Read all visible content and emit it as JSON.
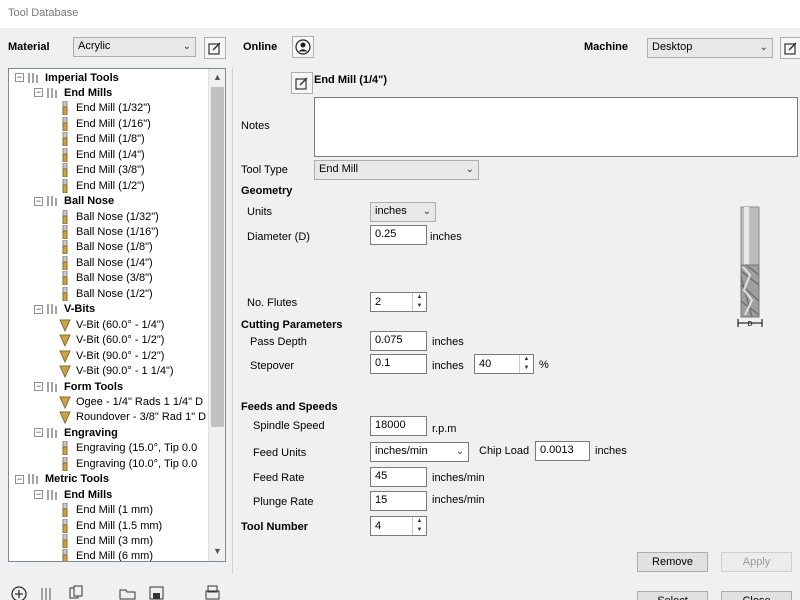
{
  "window": {
    "title": "Tool Database"
  },
  "top": {
    "material_label": "Material",
    "material_value": "Acrylic",
    "online_label": "Online",
    "machine_label": "Machine",
    "machine_value": "Desktop"
  },
  "tree": {
    "items": [
      {
        "label": "Imperial Tools",
        "level": 0,
        "kind": "group"
      },
      {
        "label": "End Mills",
        "level": 1,
        "kind": "group"
      },
      {
        "label": "End Mill (1/32\")",
        "level": 2,
        "kind": "endmill"
      },
      {
        "label": "End Mill (1/16\")",
        "level": 2,
        "kind": "endmill"
      },
      {
        "label": "End Mill (1/8\")",
        "level": 2,
        "kind": "endmill"
      },
      {
        "label": "End Mill (1/4\")",
        "level": 2,
        "kind": "endmill"
      },
      {
        "label": "End Mill (3/8\")",
        "level": 2,
        "kind": "endmill"
      },
      {
        "label": "End Mill (1/2\")",
        "level": 2,
        "kind": "endmill"
      },
      {
        "label": "Ball Nose",
        "level": 1,
        "kind": "group"
      },
      {
        "label": "Ball Nose (1/32\")",
        "level": 2,
        "kind": "endmill"
      },
      {
        "label": "Ball Nose (1/16\")",
        "level": 2,
        "kind": "endmill"
      },
      {
        "label": "Ball Nose (1/8\")",
        "level": 2,
        "kind": "endmill"
      },
      {
        "label": "Ball Nose (1/4\")",
        "level": 2,
        "kind": "endmill"
      },
      {
        "label": "Ball Nose (3/8\")",
        "level": 2,
        "kind": "endmill"
      },
      {
        "label": "Ball Nose (1/2\")",
        "level": 2,
        "kind": "endmill"
      },
      {
        "label": "V-Bits",
        "level": 1,
        "kind": "group"
      },
      {
        "label": "V-Bit (60.0° - 1/4\")",
        "level": 2,
        "kind": "vbit"
      },
      {
        "label": "V-Bit (60.0° - 1/2\")",
        "level": 2,
        "kind": "vbit"
      },
      {
        "label": "V-Bit (90.0° - 1/2\")",
        "level": 2,
        "kind": "vbit"
      },
      {
        "label": "V-Bit (90.0° - 1 1/4\")",
        "level": 2,
        "kind": "vbit"
      },
      {
        "label": "Form Tools",
        "level": 1,
        "kind": "group"
      },
      {
        "label": "Ogee - 1/4\" Rads 1 1/4\" D",
        "level": 2,
        "kind": "vbit"
      },
      {
        "label": "Roundover - 3/8\" Rad 1\" D",
        "level": 2,
        "kind": "vbit"
      },
      {
        "label": "Engraving",
        "level": 1,
        "kind": "group"
      },
      {
        "label": "Engraving (15.0°, Tip 0.0",
        "level": 2,
        "kind": "endmill"
      },
      {
        "label": "Engraving (10.0°, Tip 0.0",
        "level": 2,
        "kind": "endmill"
      },
      {
        "label": "Metric Tools",
        "level": 0,
        "kind": "group"
      },
      {
        "label": "End Mills",
        "level": 1,
        "kind": "group"
      },
      {
        "label": "End Mill (1 mm)",
        "level": 2,
        "kind": "endmill"
      },
      {
        "label": "End Mill (1.5 mm)",
        "level": 2,
        "kind": "endmill"
      },
      {
        "label": "End Mill (3 mm)",
        "level": 2,
        "kind": "endmill"
      },
      {
        "label": "End Mill (6 mm)",
        "level": 2,
        "kind": "endmill"
      }
    ]
  },
  "detail": {
    "tool_name": "End Mill (1/4\")",
    "notes_label": "Notes",
    "notes_value": "",
    "tool_type_label": "Tool Type",
    "tool_type_value": "End Mill",
    "geometry_header": "Geometry",
    "units_label": "Units",
    "units_value": "inches",
    "diameter_label": "Diameter (D)",
    "diameter_value": "0.25",
    "diameter_unit": "inches",
    "flutes_label": "No. Flutes",
    "flutes_value": "2",
    "diagram_d_label": "D",
    "cutting_header": "Cutting Parameters",
    "pass_depth_label": "Pass Depth",
    "pass_depth_value": "0.075",
    "pass_depth_unit": "inches",
    "stepover_label": "Stepover",
    "stepover_value": "0.1",
    "stepover_unit": "inches",
    "stepover_percent": "40",
    "percent_sign": "%",
    "feeds_header": "Feeds and Speeds",
    "spindle_label": "Spindle Speed",
    "spindle_value": "18000",
    "spindle_unit": "r.p.m",
    "feed_units_label": "Feed Units",
    "feed_units_value": "inches/min",
    "chip_load_label": "Chip Load",
    "chip_load_value": "0.0013",
    "chip_load_unit": "inches",
    "feed_rate_label": "Feed Rate",
    "feed_rate_value": "45",
    "feed_rate_unit": "inches/min",
    "plunge_label": "Plunge Rate",
    "plunge_value": "15",
    "plunge_unit": "inches/min",
    "tool_number_label": "Tool Number",
    "tool_number_value": "4"
  },
  "buttons": {
    "remove": "Remove",
    "apply": "Apply",
    "select": "Select",
    "close": "Close"
  }
}
